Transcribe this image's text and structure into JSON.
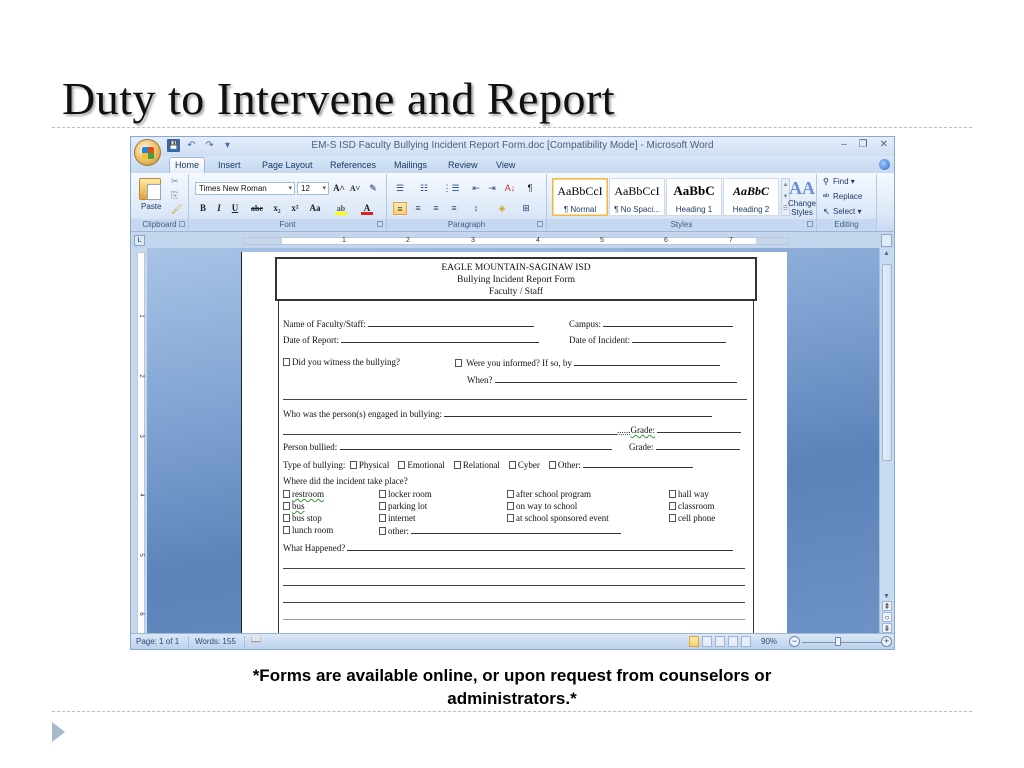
{
  "slide": {
    "title": "Duty to Intervene and Report",
    "caption_line1": "*Forms are available online, or upon request from counselors or",
    "caption_line2": "administrators.*"
  },
  "word": {
    "window_title": "EM-S ISD Faculty Bullying Incident Report Form.doc [Compatibility Mode] - Microsoft Word",
    "window_controls": {
      "minimize": "–",
      "restore": "❐",
      "close": "✕"
    },
    "quick_access": {
      "save": "💾",
      "undo": "↶",
      "redo": "↷",
      "customize": "▾"
    },
    "tabs": [
      "Home",
      "Insert",
      "Page Layout",
      "References",
      "Mailings",
      "Review",
      "View"
    ],
    "active_tab": "Home",
    "ribbon": {
      "clipboard": {
        "label": "Clipboard",
        "paste": "Paste",
        "cut": "✂",
        "copy": "⎘",
        "format_painter": "🖌"
      },
      "font": {
        "label": "Font",
        "font_name": "Times New Roman",
        "font_size": "12",
        "grow": "A˄",
        "shrink": "A˅",
        "clear": "✎",
        "bold": "B",
        "italic": "I",
        "underline": "U",
        "strike": "abe",
        "subscript": "x₂",
        "superscript": "x²",
        "change_case": "Aa",
        "highlight": "ab",
        "font_color": "A",
        "highlight_color": "#ffff00",
        "font_color_value": "#e02020"
      },
      "paragraph": {
        "label": "Paragraph",
        "bullets": "☰",
        "numbering": "☷",
        "multilevel": "⋮☰",
        "decrease_indent": "⇤",
        "increase_indent": "⇥",
        "sort": "A↓",
        "show_marks": "¶",
        "align_left": "≡",
        "center": "≡",
        "align_right": "≡",
        "justify": "≡",
        "line_spacing": "↕",
        "shading": "◈",
        "borders": "⊞"
      },
      "styles": {
        "label": "Styles",
        "items": [
          {
            "sample": "AaBbCcI",
            "name": "¶ Normal",
            "selected": true
          },
          {
            "sample": "AaBbCcI",
            "name": "¶ No Spaci...",
            "selected": false
          },
          {
            "sample": "AaBbC",
            "name": "Heading 1",
            "selected": false
          },
          {
            "sample": "AaBbC",
            "name": "Heading 2",
            "selected": false
          }
        ],
        "change_styles": "Change Styles",
        "change_styles_icon": "AA"
      },
      "editing": {
        "label": "Editing",
        "find": "Find",
        "replace": "Replace",
        "select": "Select"
      }
    },
    "ruler": {
      "h_numbers": [
        "1",
        "2",
        "3",
        "4",
        "5",
        "6",
        "7"
      ],
      "v_numbers": [
        "1",
        "2",
        "3",
        "4",
        "5",
        "6"
      ]
    },
    "document": {
      "header": [
        "EAGLE MOUNTAIN-SAGINAW  ISD",
        "Bullying Incident Report Form",
        "Faculty / Staff"
      ],
      "fields": {
        "name_label": "Name of Faculty/Staff:",
        "campus_label": "Campus:",
        "date_report_label": "Date of Report:",
        "date_incident_label": "Date  of Incident:",
        "witness_label": "Did you witness  the bullying?",
        "informed_label": "Were you informed? If so, by",
        "when_label": "When?",
        "who_label": "Who was the person(s)  engaged  in bullying:",
        "grade_label": "Grade:",
        "grade_dots": "......",
        "person_bullied_label": "Person bullied:",
        "type_label": "Type of bullying:",
        "types": [
          "Physical",
          "Emotional",
          "Relational",
          "Cyber",
          "Other:"
        ],
        "where_label": "Where did the incident take place?",
        "locations": [
          [
            "restroom",
            "locker  room",
            "after school program",
            "hall way"
          ],
          [
            "bus",
            "parking  lot",
            "on way  to school",
            "classroom"
          ],
          [
            "bus  stop",
            "internet",
            "at school  sponsored  event",
            "cell phone"
          ],
          [
            "lunch  room",
            "other:"
          ]
        ],
        "what_happened_label": "What Happened?"
      }
    },
    "status": {
      "page": "Page: 1 of 1",
      "words": "Words: 155",
      "proofing_icon": "📖",
      "zoom": "90%",
      "zoom_level": 0.9,
      "zoom_out": "−",
      "zoom_in": "+"
    },
    "scrollbar": {
      "up": "▲",
      "down": "▼",
      "prev_page": "⇞",
      "browse": "○",
      "next_page": "⇟"
    }
  }
}
